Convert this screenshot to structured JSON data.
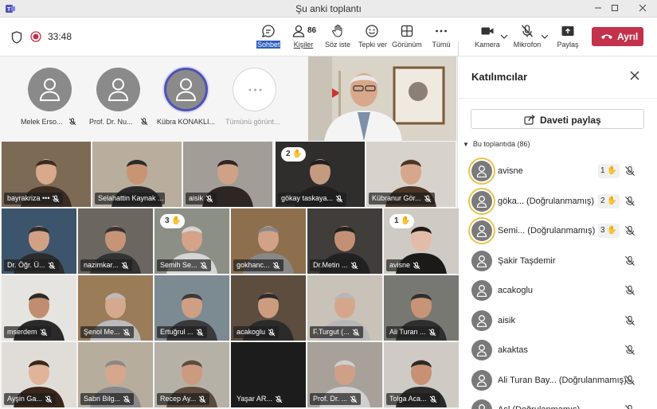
{
  "window": {
    "title": "Şu anki toplantı",
    "controls": [
      "minimize",
      "maximize",
      "close"
    ]
  },
  "toolbar": {
    "timer": "33:48",
    "chat_label": "Sohbet",
    "people_label": "Kişiler",
    "people_count": "86",
    "raise_hand_label": "Söz iste",
    "react_label": "Tepki ver",
    "view_label": "Görünüm",
    "more_label": "Tümü",
    "camera_label": "Kamera",
    "mic_label": "Mikrofon",
    "share_label": "Paylaş",
    "leave_label": "Ayrıl",
    "leave_color": "#c4314b"
  },
  "avatars": [
    {
      "name": "Melek Erso..."
    },
    {
      "name": "Prof. Dr. Nu..."
    },
    {
      "name": "Kübra KONAKLI..."
    },
    {
      "name": "Tümünü görünt..."
    }
  ],
  "grid": [
    {
      "name": "bayrakriza",
      "more": "•••",
      "hand": ""
    },
    {
      "name": "Selahattin Kaynak ...",
      "hand": ""
    },
    {
      "name": "aisik",
      "hand": ""
    },
    {
      "name": "gökay taskaya...",
      "hand": "2"
    },
    {
      "name": "Kübranur Gör...",
      "hand": ""
    },
    {
      "name": "Dr. Öğr. Ü...",
      "hand": ""
    },
    {
      "name": "nazimkar...",
      "hand": ""
    },
    {
      "name": "Semih Se...",
      "hand": "3"
    },
    {
      "name": "gokhanc...",
      "hand": ""
    },
    {
      "name": "Dr.Metin ...",
      "hand": ""
    },
    {
      "name": "avisne",
      "hand": "1"
    },
    {
      "name": "mserdem",
      "hand": ""
    },
    {
      "name": "Şenol Me...",
      "hand": ""
    },
    {
      "name": "Ertuğrul ...",
      "hand": ""
    },
    {
      "name": "acakoglu",
      "hand": ""
    },
    {
      "name": "F.Turgut (...",
      "hand": ""
    },
    {
      "name": "Ali Turan ...",
      "hand": ""
    },
    {
      "name": "Ayşin Ga...",
      "hand": ""
    },
    {
      "name": "Sabri Bilg...",
      "hand": ""
    },
    {
      "name": "Recep Ay...",
      "hand": ""
    },
    {
      "name": "Yaşar AR...",
      "hand": ""
    },
    {
      "name": "Prof. Dr. ...",
      "hand": ""
    },
    {
      "name": "Tolga Aca...",
      "hand": ""
    }
  ],
  "panel": {
    "title": "Katılımcılar",
    "share_invite": "Daveti paylaş",
    "section_label": "Bu toplantıda (86)",
    "participants": [
      {
        "name": "avisne",
        "hand": "1"
      },
      {
        "name": "göka... (Doğrulanmamış)",
        "hand": "2"
      },
      {
        "name": "Semi... (Doğrulanmamış)",
        "hand": "3"
      },
      {
        "name": "Şakir Taşdemir",
        "hand": ""
      },
      {
        "name": "acakoglu",
        "hand": ""
      },
      {
        "name": "aisik",
        "hand": ""
      },
      {
        "name": "akaktas",
        "hand": ""
      },
      {
        "name": "Ali Turan Bay... (Doğrulanmamış)",
        "hand": ""
      },
      {
        "name": "Asl (Doğrulanmamış)",
        "hand": ""
      }
    ]
  },
  "colors": {
    "accent": "#4f52b2",
    "raised_hand_border": "#e8c44d",
    "chat_highlight": "#2f5dbd"
  },
  "icons": [
    "teams-logo-icon",
    "shield-icon",
    "record-icon",
    "chat-icon",
    "people-icon",
    "raise-hand-icon",
    "react-icon",
    "view-grid-icon",
    "more-icon",
    "camera-icon",
    "mic-off-icon",
    "share-tray-icon",
    "phone-hangup-icon",
    "close-icon",
    "share-icon",
    "person-icon"
  ]
}
